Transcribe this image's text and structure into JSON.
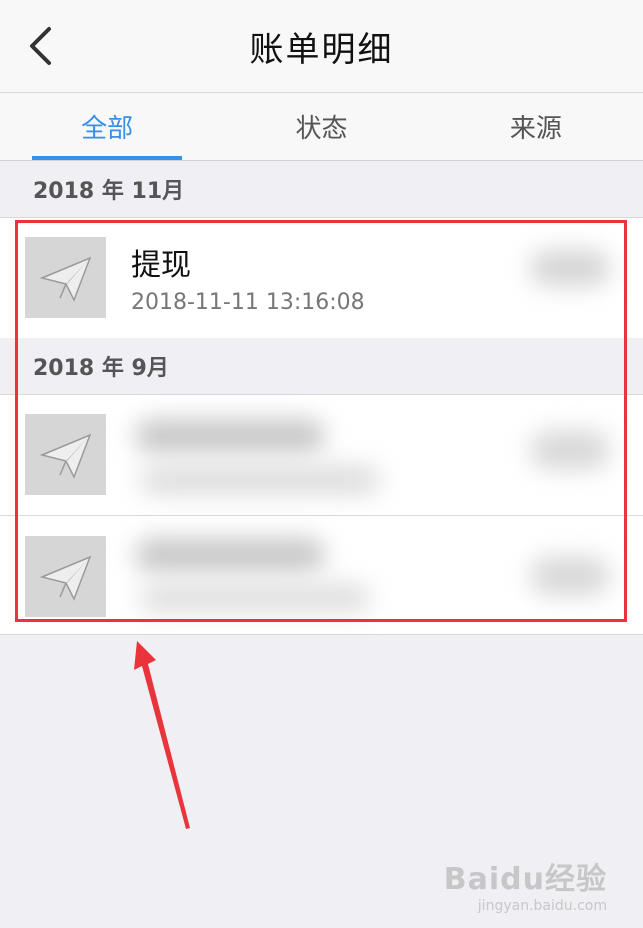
{
  "navbar": {
    "title": "账单明细"
  },
  "tabs": [
    {
      "label": "全部",
      "active": true
    },
    {
      "label": "状态",
      "active": false
    },
    {
      "label": "来源",
      "active": false
    }
  ],
  "sections": [
    {
      "header": "2018 年 11月",
      "items": [
        {
          "title": "提现",
          "time": "2018-11-11 13:16:08",
          "icon": "paper-plane-icon"
        }
      ]
    },
    {
      "header": "2018 年 9月",
      "items": [
        {
          "icon": "paper-plane-icon",
          "blurred": true
        },
        {
          "icon": "paper-plane-icon",
          "blurred": true
        }
      ]
    }
  ],
  "annotation": {
    "box_color": "#e8343a",
    "arrow_color": "#e8343a"
  },
  "watermark": {
    "logo": "Baidu经验",
    "url": "jingyan.baidu.com"
  },
  "colors": {
    "accent": "#3a8ee6",
    "background": "#efeff4"
  }
}
